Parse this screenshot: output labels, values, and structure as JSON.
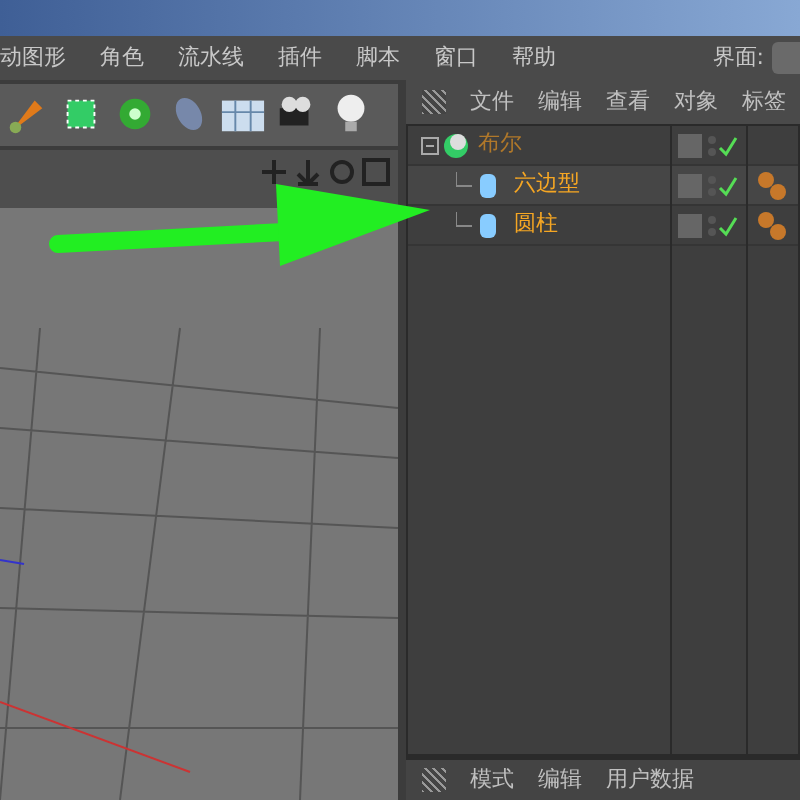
{
  "menu": [
    "动图形",
    "角色",
    "流水线",
    "插件",
    "脚本",
    "窗口",
    "帮助"
  ],
  "layout_label": "界面:",
  "object_manager": {
    "menu": [
      "文件",
      "编辑",
      "查看",
      "对象",
      "标签"
    ],
    "objects": [
      {
        "name": "布尔",
        "selected": false,
        "enabled": true,
        "tag": false,
        "children": [
          {
            "name": "六边型",
            "selected": true,
            "enabled": true,
            "tag": true
          },
          {
            "name": "圆柱",
            "selected": true,
            "enabled": true,
            "tag": true
          }
        ]
      }
    ]
  },
  "attribute_manager": {
    "menu": [
      "模式",
      "编辑",
      "用户数据"
    ]
  }
}
